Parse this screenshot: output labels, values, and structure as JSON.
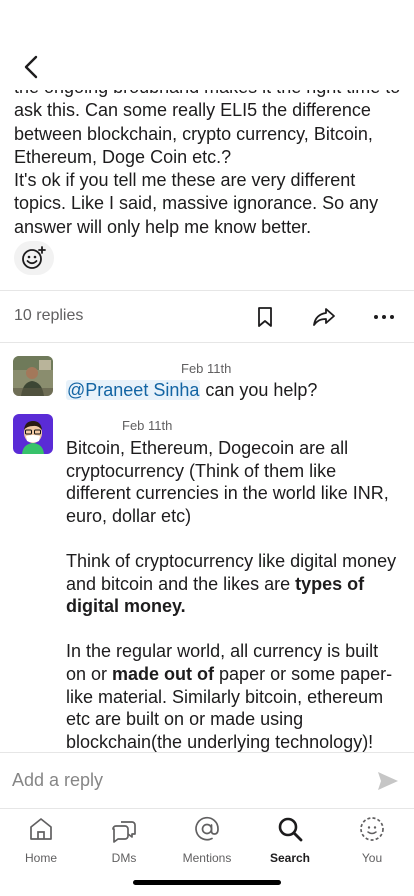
{
  "post": {
    "paragraphs": [
      "the ongoing broubhand makes it the right time to ask this. Can some really ELI5 the difference between blockchain, crypto currency, Bitcoin, Ethereum, Doge Coin etc.?",
      "It's ok if you tell me these are very different topics. Like I said, massive ignorance. So any answer will only help me know better."
    ]
  },
  "thread": {
    "reply_count": "10 replies"
  },
  "messages": [
    {
      "timestamp": "Feb 11th",
      "mention": "@Praneet Sinha",
      "text": " can you help?"
    },
    {
      "timestamp": "Feb 11th",
      "p1": "Bitcoin, Ethereum, Dogecoin are all cryptocurrency (Think of them like different currencies in the world like INR, euro, dollar etc)",
      "p2_a": "Think of cryptocurrency like digital money and bitcoin and the likes are ",
      "p2_b": "types of digital money.",
      "p3_a": "In the regular world, all currency is built on or ",
      "p3_b": "made out of",
      "p3_c": " paper or some paper-like material. Similarly bitcoin, ethereum etc are built on or made using blockchain(the underlying technology)!"
    }
  ],
  "composer": {
    "placeholder": "Add a reply"
  },
  "tabs": [
    {
      "label": "Home",
      "icon": "home-icon"
    },
    {
      "label": "DMs",
      "icon": "dms-icon"
    },
    {
      "label": "Mentions",
      "icon": "mentions-icon"
    },
    {
      "label": "Search",
      "icon": "search-icon",
      "active": true
    },
    {
      "label": "You",
      "icon": "you-icon"
    }
  ],
  "colors": {
    "mention_text": "#1264a3",
    "mention_bg": "#e8f2fa",
    "muted": "#616061",
    "divider": "#e6e6e6"
  }
}
